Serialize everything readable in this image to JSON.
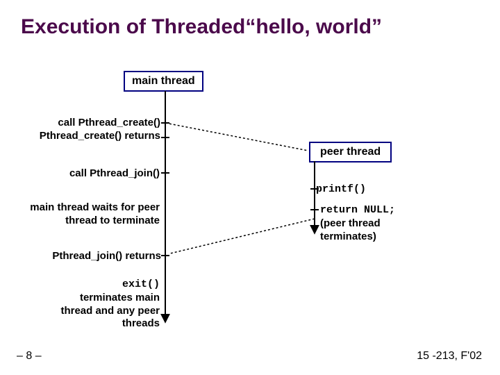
{
  "title": "Execution of Threaded“hello, world”",
  "boxes": {
    "main": "main thread",
    "peer": "peer thread"
  },
  "labels": {
    "create": "call Pthread_create()\nPthread_create() returns",
    "join": "call Pthread_join()",
    "wait": "main thread waits for peer  thread to terminate",
    "joinret": "Pthread_join() returns",
    "exit": "exit()\nterminates main thread and any peer threads",
    "printf": "printf()",
    "return": "return NULL;\n(peer thread terminates)"
  },
  "footer": {
    "left": "– 8 –",
    "right": "15 -213, F'02"
  },
  "colors": {
    "title": "#4b0a4b",
    "border": "#000080"
  }
}
